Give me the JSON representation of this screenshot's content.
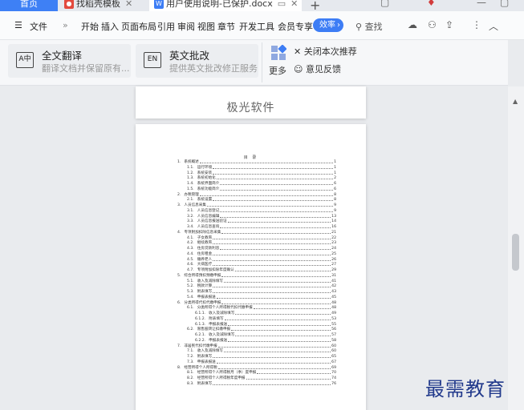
{
  "tabs": {
    "home": "首页",
    "items": [
      {
        "label": "找稻壳模板",
        "color": "#e34a3e",
        "icon": "daoke-icon"
      },
      {
        "label": "用户使用说明-已保护.docx",
        "color": "#3d7df5",
        "icon": "word-doc-icon"
      }
    ],
    "add": "+"
  },
  "menu": {
    "file": "文件",
    "overflow": "»",
    "items": [
      "开始",
      "插入",
      "页面布局",
      "引用",
      "审阅",
      "视图",
      "章节",
      "开发工具",
      "会员专享"
    ],
    "vip_badge": "效率",
    "search": "查找"
  },
  "ribbon": {
    "features": [
      {
        "title": "全文翻译",
        "desc": "翻译文档并保留原有...",
        "icon_text": "A中"
      },
      {
        "title": "英文批改",
        "desc": "提供英文批改修正服务",
        "icon_text": "EN"
      }
    ],
    "more": "更多",
    "close_recommend": "关闭本次推荐",
    "feedback": "意见反馈"
  },
  "document": {
    "header_text": "极光软件",
    "toc_title": "目 录",
    "toc": [
      {
        "num": "1.",
        "text": "系统概述",
        "page": "1",
        "level": 1
      },
      {
        "num": "1.1.",
        "text": "运行环境",
        "page": "1",
        "level": 2
      },
      {
        "num": "1.2.",
        "text": "系统安装",
        "page": "1",
        "level": 2
      },
      {
        "num": "1.3.",
        "text": "系统初始化",
        "page": "2",
        "level": 2
      },
      {
        "num": "1.4.",
        "text": "系统界面简介",
        "page": "6",
        "level": 2
      },
      {
        "num": "1.5.",
        "text": "系统功能简介",
        "page": "6",
        "level": 2
      },
      {
        "num": "2.",
        "text": "办税管理",
        "page": "8",
        "level": 1
      },
      {
        "num": "2.1.",
        "text": "系统设置",
        "page": "8",
        "level": 2
      },
      {
        "num": "3.",
        "text": "人员信息采集",
        "page": "9",
        "level": 1
      },
      {
        "num": "3.1.",
        "text": "人员信息登记",
        "page": "9",
        "level": 2
      },
      {
        "num": "3.2.",
        "text": "人员信息编辑",
        "page": "13",
        "level": 2
      },
      {
        "num": "3.3.",
        "text": "人员信息报送验证",
        "page": "14",
        "level": 2
      },
      {
        "num": "3.4.",
        "text": "人员信息查询",
        "page": "16",
        "level": 2
      },
      {
        "num": "4.",
        "text": "专项附加扣除信息采集",
        "page": "21",
        "level": 1
      },
      {
        "num": "4.1.",
        "text": "子女教育",
        "page": "22",
        "level": 2
      },
      {
        "num": "4.2.",
        "text": "继续教育",
        "page": "23",
        "level": 2
      },
      {
        "num": "4.3.",
        "text": "住房贷款利息",
        "page": "24",
        "level": 2
      },
      {
        "num": "4.4.",
        "text": "住房租金",
        "page": "25",
        "level": 2
      },
      {
        "num": "4.5.",
        "text": "赡养老人",
        "page": "26",
        "level": 2
      },
      {
        "num": "4.6.",
        "text": "大病医疗",
        "page": "27",
        "level": 2
      },
      {
        "num": "4.7.",
        "text": "专项附加扣除年度确认",
        "page": "29",
        "level": 2
      },
      {
        "num": "5.",
        "text": "综合所得预扣预缴申报",
        "page": "31",
        "level": 1
      },
      {
        "num": "5.1.",
        "text": "收入及减除填写",
        "page": "41",
        "level": 2
      },
      {
        "num": "5.2.",
        "text": "税款计算",
        "page": "42",
        "level": 2
      },
      {
        "num": "5.3.",
        "text": "附表填写",
        "page": "43",
        "level": 2
      },
      {
        "num": "5.4.",
        "text": "申报表报送",
        "page": "45",
        "level": 2
      },
      {
        "num": "6.",
        "text": "分类所得代扣代缴申报",
        "page": "48",
        "level": 1
      },
      {
        "num": "6.1.",
        "text": "分类所得个人所得税代扣代缴申报",
        "page": "48",
        "level": 2
      },
      {
        "num": "6.1.1.",
        "text": "收入及减除填写",
        "page": "49",
        "level": 3
      },
      {
        "num": "6.1.2.",
        "text": "附表填写",
        "page": "53",
        "level": 3
      },
      {
        "num": "6.1.3.",
        "text": "申报表报送",
        "page": "55",
        "level": 3
      },
      {
        "num": "6.2.",
        "text": "限售股转让扣缴申报",
        "page": "56",
        "level": 2
      },
      {
        "num": "6.2.1.",
        "text": "收入及减除填写",
        "page": "57",
        "level": 3
      },
      {
        "num": "6.2.2.",
        "text": "申报表报送",
        "page": "58",
        "level": 3
      },
      {
        "num": "7.",
        "text": "非居民代扣代缴申报",
        "page": "60",
        "level": 1
      },
      {
        "num": "7.1.",
        "text": "收入及减除填写",
        "page": "60",
        "level": 2
      },
      {
        "num": "7.2.",
        "text": "附表填写",
        "page": "65",
        "level": 2
      },
      {
        "num": "7.3.",
        "text": "申报表报送",
        "page": "67",
        "level": 2
      },
      {
        "num": "8.",
        "text": "经营所得个人所得税",
        "page": "69",
        "level": 1
      },
      {
        "num": "8.1.",
        "text": "经营所得个人所得税月（季）度申报",
        "page": "70",
        "level": 2
      },
      {
        "num": "8.2.",
        "text": "经营所得个人所得税年度申报",
        "page": "74",
        "level": 2
      },
      {
        "num": "8.3.",
        "text": "附表填写",
        "page": "76",
        "level": 2
      }
    ]
  },
  "watermark": "最需教育",
  "colors": {
    "accent": "#3d7df5",
    "home_tab": "#3e80f5",
    "watermark": "#223a8c"
  }
}
